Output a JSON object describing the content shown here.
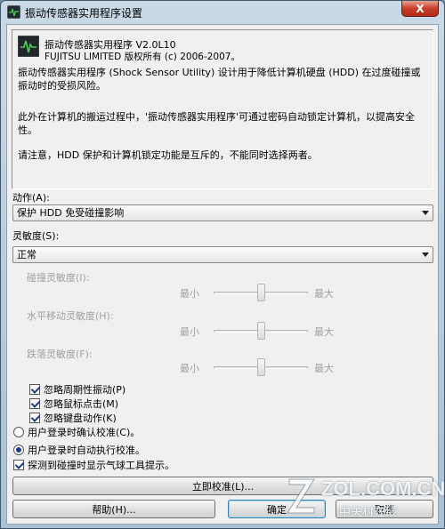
{
  "window": {
    "title": "振动传感器实用程序设置",
    "close_label": "X"
  },
  "info": {
    "version": "振动传感器实用程序 V2.0L10",
    "copyright": "FUJITSU LIMITED 版权所有 (c) 2006-2007。",
    "para1": "振动传感器实用程序 (Shock Sensor Utility) 设计用于降低计算机硬盘 (HDD) 在过度碰撞或振动时的受损风险。",
    "para2": "此外在计算机的搬运过程中，'振动传感器实用程序'可通过密码自动锁定计算机，以提高安全性。",
    "para3": "请注意，HDD 保护和计算机锁定功能是互斥的，不能同时选择两者。"
  },
  "action": {
    "label": "动作(A):",
    "selected": "保护 HDD 免受碰撞影响"
  },
  "sensitivity": {
    "label": "灵敏度(S):",
    "selected": "正常",
    "min_label": "最小",
    "max_label": "最大",
    "sliders": [
      {
        "label": "碰撞灵敏度(I):",
        "value": 0.5
      },
      {
        "label": "水平移动灵敏度(H):",
        "value": 0.5
      },
      {
        "label": "跌落灵敏度(F):",
        "value": 0.5
      }
    ]
  },
  "options": {
    "ignore_periodic": "忽略周期性振动(P)",
    "ignore_mouse": "忽略鼠标点击(M)",
    "ignore_keyboard": "忽略键盘动作(K)",
    "radio_confirm": "用户登录时确认校准(C)。",
    "radio_auto": "用户登录时自动执行校准。",
    "balloon_tip": "探测到碰撞时显示气球工具提示。"
  },
  "buttons": {
    "calibrate": "立即校准(L)...",
    "help": "帮助(H)...",
    "ok": "确定",
    "cancel": "取消"
  },
  "watermark": {
    "text": "ZOL.COM.CN",
    "sub": "中关村在线"
  },
  "colors": {
    "titlebar": "#b7cddd",
    "close": "#c8402a",
    "dialog_bg": "#f0f0f0",
    "check_mark": "#1d3b8a"
  }
}
